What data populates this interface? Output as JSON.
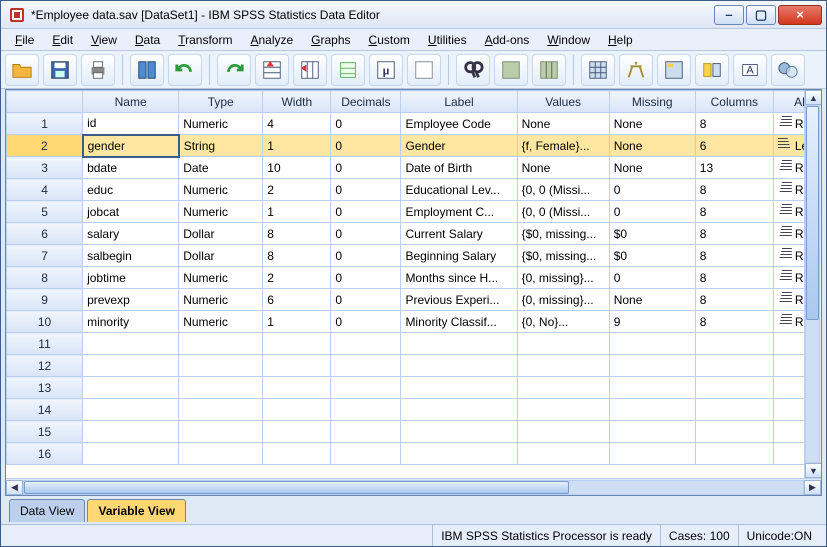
{
  "window": {
    "title": "*Employee data.sav [DataSet1] - IBM SPSS Statistics Data Editor",
    "min_label": "–",
    "max_label": "▢",
    "close_label": "×"
  },
  "menu": [
    "File",
    "Edit",
    "View",
    "Data",
    "Transform",
    "Analyze",
    "Graphs",
    "Custom",
    "Utilities",
    "Add-ons",
    "Window",
    "Help"
  ],
  "toolbar_icons": [
    "open-icon",
    "save-icon",
    "print-icon",
    "recall-icon",
    "undo-icon",
    "redo-icon",
    "goto-case-icon",
    "goto-var-icon",
    "variables-icon",
    "run-icon",
    "select-icon",
    "find-icon",
    "insert-case-icon",
    "insert-var-icon",
    "split-icon",
    "weight-icon",
    "value-labels-icon",
    "use-sets-icon",
    "show-all-icon",
    "spellcheck-icon"
  ],
  "columns": [
    "",
    "Name",
    "Type",
    "Width",
    "Decimals",
    "Label",
    "Values",
    "Missing",
    "Columns",
    "Al"
  ],
  "rows": [
    {
      "n": "1",
      "name": "id",
      "type": "Numeric",
      "width": "4",
      "dec": "0",
      "label": "Employee Code",
      "values": "None",
      "missing": "None",
      "cols": "8",
      "align": "Righ",
      "adir": "right"
    },
    {
      "n": "2",
      "name": "gender",
      "type": "String",
      "width": "1",
      "dec": "0",
      "label": "Gender",
      "values": "{f, Female}...",
      "missing": "None",
      "cols": "6",
      "align": "Left",
      "adir": "left",
      "selected": true
    },
    {
      "n": "3",
      "name": "bdate",
      "type": "Date",
      "width": "10",
      "dec": "0",
      "label": "Date of Birth",
      "values": "None",
      "missing": "None",
      "cols": "13",
      "align": "Righ",
      "adir": "right"
    },
    {
      "n": "4",
      "name": "educ",
      "type": "Numeric",
      "width": "2",
      "dec": "0",
      "label": "Educational Lev...",
      "values": "{0, 0 (Missi...",
      "missing": "0",
      "cols": "8",
      "align": "Righ",
      "adir": "right"
    },
    {
      "n": "5",
      "name": "jobcat",
      "type": "Numeric",
      "width": "1",
      "dec": "0",
      "label": "Employment C...",
      "values": "{0, 0 (Missi...",
      "missing": "0",
      "cols": "8",
      "align": "Righ",
      "adir": "right"
    },
    {
      "n": "6",
      "name": "salary",
      "type": "Dollar",
      "width": "8",
      "dec": "0",
      "label": "Current Salary",
      "values": "{$0, missing...",
      "missing": "$0",
      "cols": "8",
      "align": "Righ",
      "adir": "right"
    },
    {
      "n": "7",
      "name": "salbegin",
      "type": "Dollar",
      "width": "8",
      "dec": "0",
      "label": "Beginning Salary",
      "values": "{$0, missing...",
      "missing": "$0",
      "cols": "8",
      "align": "Righ",
      "adir": "right"
    },
    {
      "n": "8",
      "name": "jobtime",
      "type": "Numeric",
      "width": "2",
      "dec": "0",
      "label": "Months since H...",
      "values": "{0, missing}...",
      "missing": "0",
      "cols": "8",
      "align": "Righ",
      "adir": "right"
    },
    {
      "n": "9",
      "name": "prevexp",
      "type": "Numeric",
      "width": "6",
      "dec": "0",
      "label": "Previous Experi...",
      "values": "{0, missing}...",
      "missing": "None",
      "cols": "8",
      "align": "Righ",
      "adir": "right"
    },
    {
      "n": "10",
      "name": "minority",
      "type": "Numeric",
      "width": "1",
      "dec": "0",
      "label": "Minority Classif...",
      "values": "{0, No}...",
      "missing": "9",
      "cols": "8",
      "align": "Righ",
      "adir": "right"
    }
  ],
  "empty_rows": [
    "11",
    "12",
    "13",
    "14",
    "15",
    "16"
  ],
  "tabs": {
    "data_view": "Data View",
    "variable_view": "Variable View"
  },
  "status": {
    "processor": "IBM SPSS Statistics Processor is ready",
    "cases": "Cases: 100",
    "unicode": "Unicode:ON"
  }
}
